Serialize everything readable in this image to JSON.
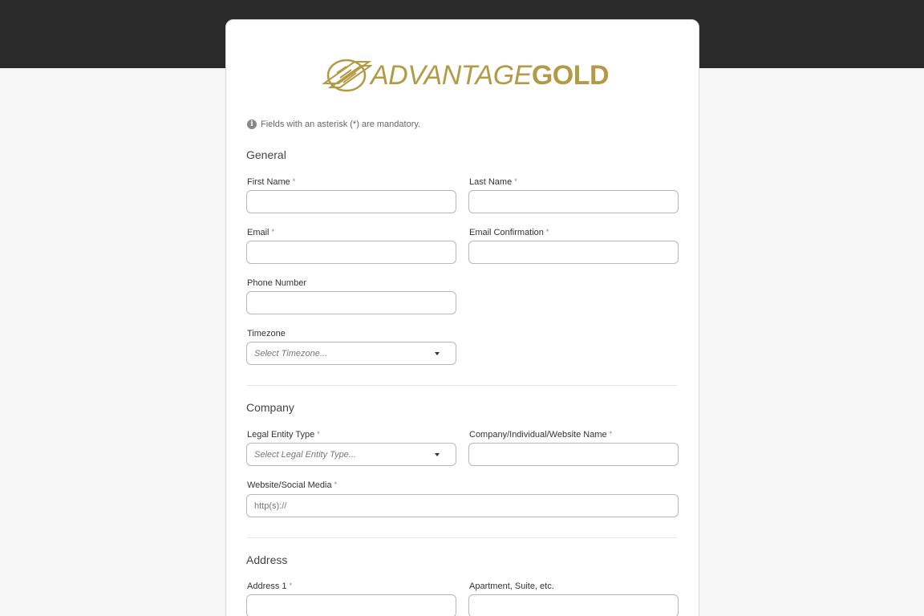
{
  "brand": {
    "name_part1": "ADVANTAGE",
    "name_part2": "GOLD",
    "color": "#b49a45"
  },
  "notice": "Fields with an asterisk (*) are mandatory.",
  "sections": {
    "general": {
      "title": "General",
      "first_name_label": "First Name",
      "last_name_label": "Last Name",
      "email_label": "Email",
      "email_confirmation_label": "Email Confirmation",
      "phone_label": "Phone Number",
      "timezone_label": "Timezone",
      "timezone_placeholder": "Select Timezone..."
    },
    "company": {
      "title": "Company",
      "legal_entity_label": "Legal Entity Type",
      "legal_entity_placeholder": "Select Legal Entity Type...",
      "company_name_label": "Company/Individual/Website Name",
      "website_label": "Website/Social Media",
      "website_placeholder": "http(s)://"
    },
    "address": {
      "title": "Address",
      "address1_label": "Address 1",
      "apartment_label": "Apartment, Suite, etc."
    }
  },
  "required_marker": "*"
}
